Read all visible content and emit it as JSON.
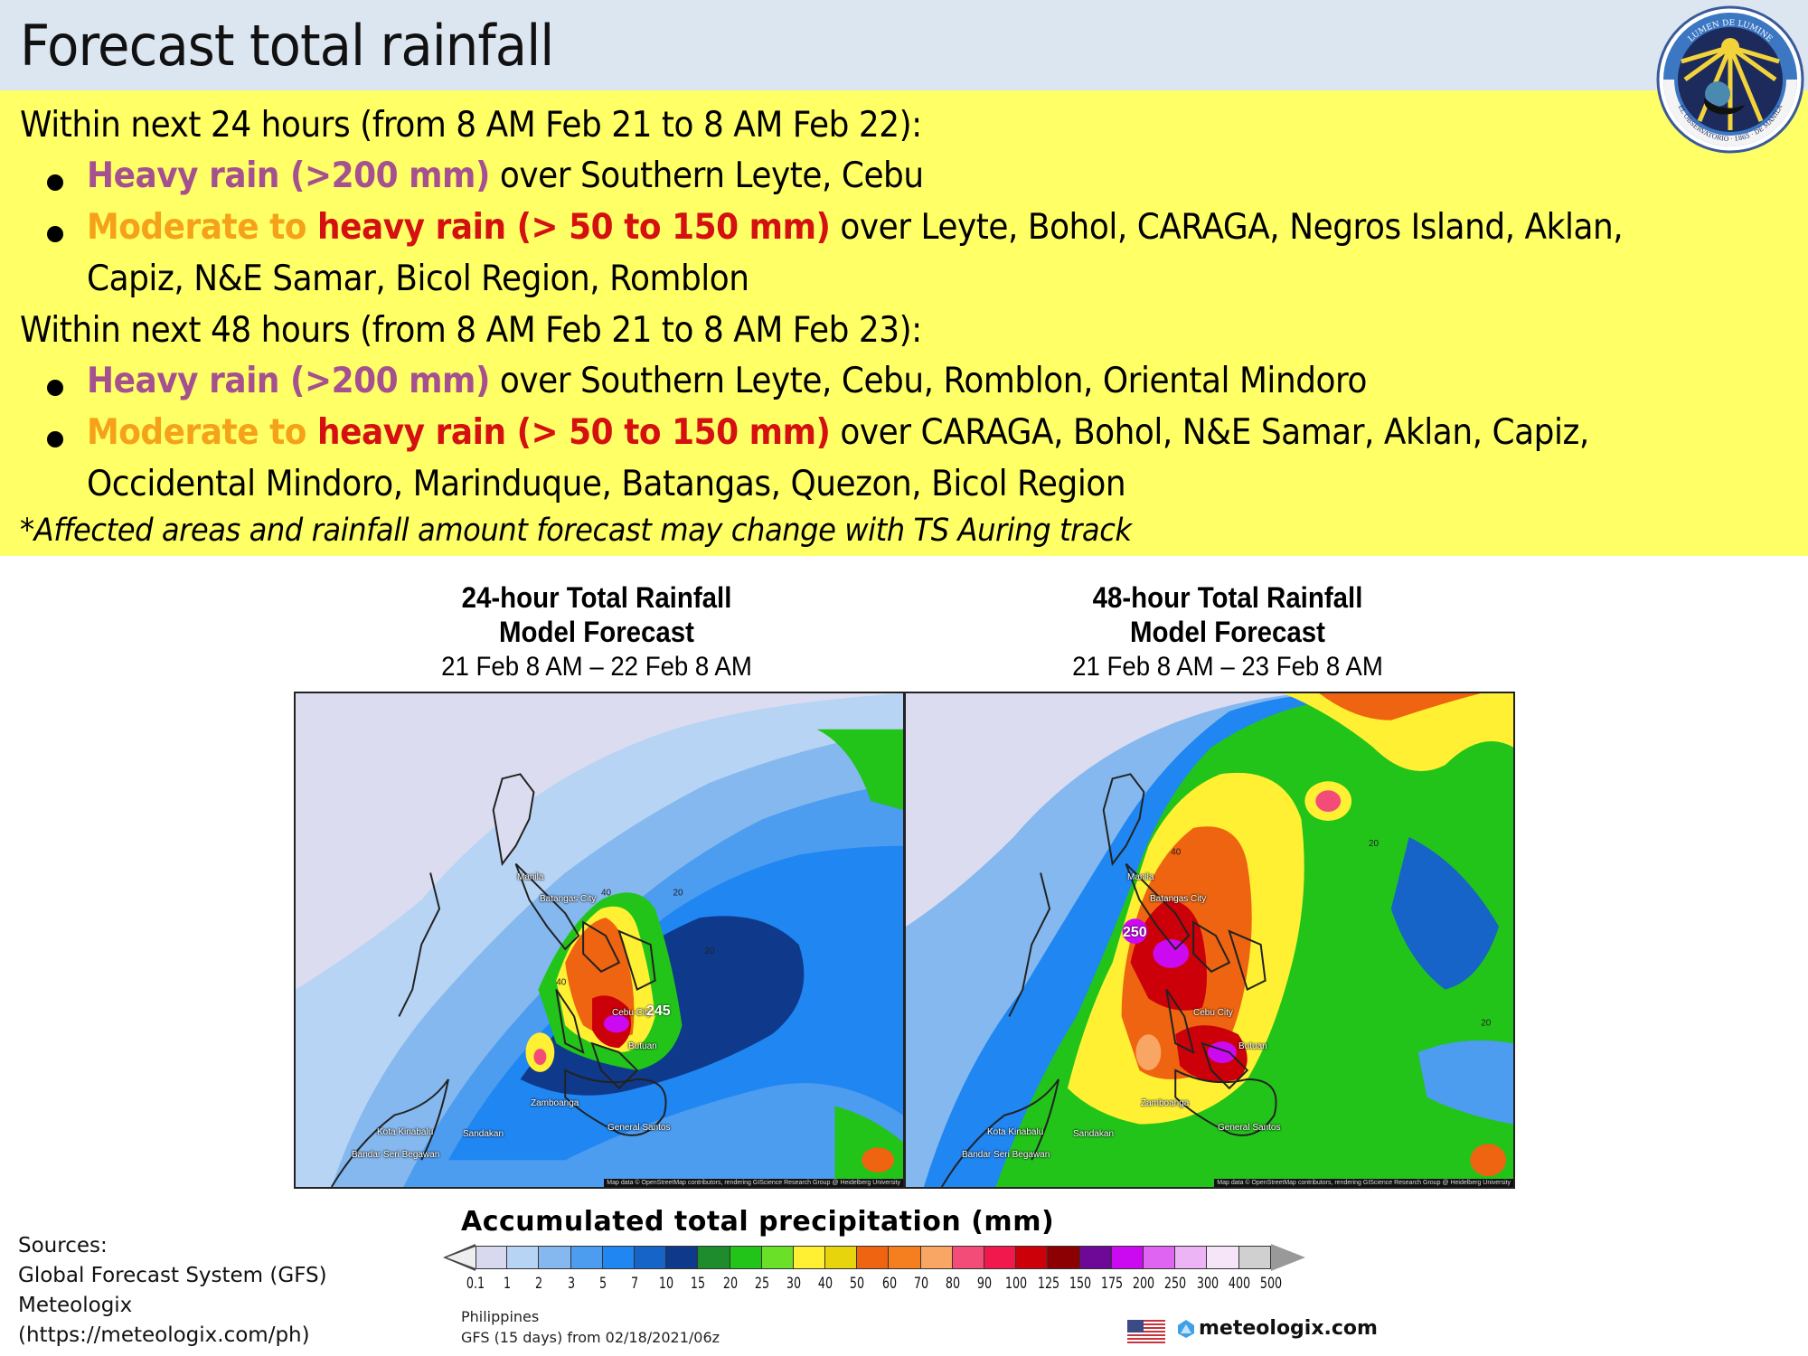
{
  "header": {
    "title": "Forecast total rainfall",
    "logo": {
      "icon": "pagasa-observatory-seal-icon",
      "motto_top": "LUMEN DE LUMINE",
      "motto_bottom": "EL OBSERVATORIO · 1865 · DE MANILA"
    }
  },
  "summary": {
    "period_24": {
      "heading": "Within next 24 hours (from 8 AM Feb 21 to 8 AM Feb 22):",
      "items": [
        {
          "parts": [
            {
              "text": "Heavy rain (>200 mm)",
              "style": "purple"
            },
            {
              "text": " over Southern Leyte, Cebu",
              "style": "plain"
            }
          ]
        },
        {
          "parts": [
            {
              "text": "Moderate to ",
              "style": "orange"
            },
            {
              "text": "heavy rain (> 50 to 150 mm)",
              "style": "red"
            },
            {
              "text": " over Leyte, Bohol, CARAGA, Negros Island, Aklan,",
              "style": "plain"
            }
          ],
          "continuation": "Capiz, N&E Samar, Bicol Region, Romblon"
        }
      ]
    },
    "period_48": {
      "heading": "Within next 48 hours (from 8 AM Feb 21 to 8 AM Feb 23):",
      "items": [
        {
          "parts": [
            {
              "text": "Heavy rain (>200 mm)",
              "style": "purple"
            },
            {
              "text": " over Southern Leyte, Cebu, Romblon, Oriental Mindoro",
              "style": "plain"
            }
          ]
        },
        {
          "parts": [
            {
              "text": "Moderate to ",
              "style": "orange"
            },
            {
              "text": "heavy rain (> 50 to 150 mm)",
              "style": "red"
            },
            {
              "text": " over CARAGA, Bohol, N&E Samar, Aklan, Capiz,",
              "style": "plain"
            }
          ],
          "continuation": "Occidental Mindoro, Marinduque, Batangas, Quezon, Bicol Region"
        }
      ]
    },
    "note": "*Affected areas and rainfall amount forecast may change with TS Auring track"
  },
  "colors": {
    "header_bg": "#dce6f1",
    "summary_bg": "#ffff66",
    "heavy_purple": "#a5508f",
    "moderate_orange": "#f5a11a",
    "heavy_red": "#d41010"
  },
  "maps": [
    {
      "title_line1": "24-hour Total Rainfall",
      "title_line2": "Model Forecast",
      "period": "21 Feb 8 AM – 22 Feb 8 AM",
      "peak_label": "245",
      "cities": [
        "Manila",
        "Batangas City",
        "Cebu City",
        "Butuan",
        "Zamboanga",
        "General Santos",
        "Kota Kinabalu",
        "Sandakan",
        "Bandar Seri Begawan"
      ],
      "contour_labels": [
        "40",
        "20",
        "40",
        "20"
      ],
      "attribution": "Map data © OpenStreetMap contributors, rendering GIScience Research Group @ Heidelberg University"
    },
    {
      "title_line1": "48-hour Total Rainfall",
      "title_line2": "Model Forecast",
      "period": "21 Feb 8 AM – 23 Feb 8 AM",
      "peak_label": "250",
      "cities": [
        "Manila",
        "Batangas City",
        "Cebu City",
        "Butuan",
        "Zamboanga",
        "General Santos",
        "Kota Kinabalu",
        "Sandakan",
        "Bandar Seri Begawan"
      ],
      "contour_labels": [
        "40",
        "20",
        "20"
      ],
      "attribution": "Map data © OpenStreetMap contributors, rendering GIScience Research Group @ Heidelberg University"
    }
  ],
  "legend": {
    "title": "Accumulated total precipitation (mm)",
    "ticks": [
      "0.1",
      "1",
      "2",
      "3",
      "5",
      "7",
      "10",
      "15",
      "20",
      "25",
      "30",
      "40",
      "50",
      "60",
      "70",
      "80",
      "90",
      "100",
      "125",
      "150",
      "175",
      "200",
      "250",
      "300",
      "400",
      "500"
    ],
    "colors": [
      "#d8d8ee",
      "#b8d4f4",
      "#84b8ee",
      "#4c9cf0",
      "#1f86f2",
      "#1664c8",
      "#0f3a8c",
      "#1e8c2c",
      "#22c41a",
      "#6ae028",
      "#fff033",
      "#e8d40c",
      "#ee6410",
      "#f57f1e",
      "#f9a664",
      "#f44c78",
      "#f0184c",
      "#cc0008",
      "#8c0004",
      "#6e0896",
      "#cc0af2",
      "#e064f2",
      "#ecb4f4",
      "#f6e4f8",
      "#d0d0d0"
    ],
    "region": "Philippines",
    "model_run": "GFS (15 days) from 02/18/2021/06z",
    "brand": "meteologix.com",
    "flag_icon": "us-flag-icon"
  },
  "sources": {
    "label": "Sources:",
    "lines": [
      "Global Forecast System (GFS)",
      "Meteologix",
      "(https://meteologix.com/ph)"
    ]
  }
}
